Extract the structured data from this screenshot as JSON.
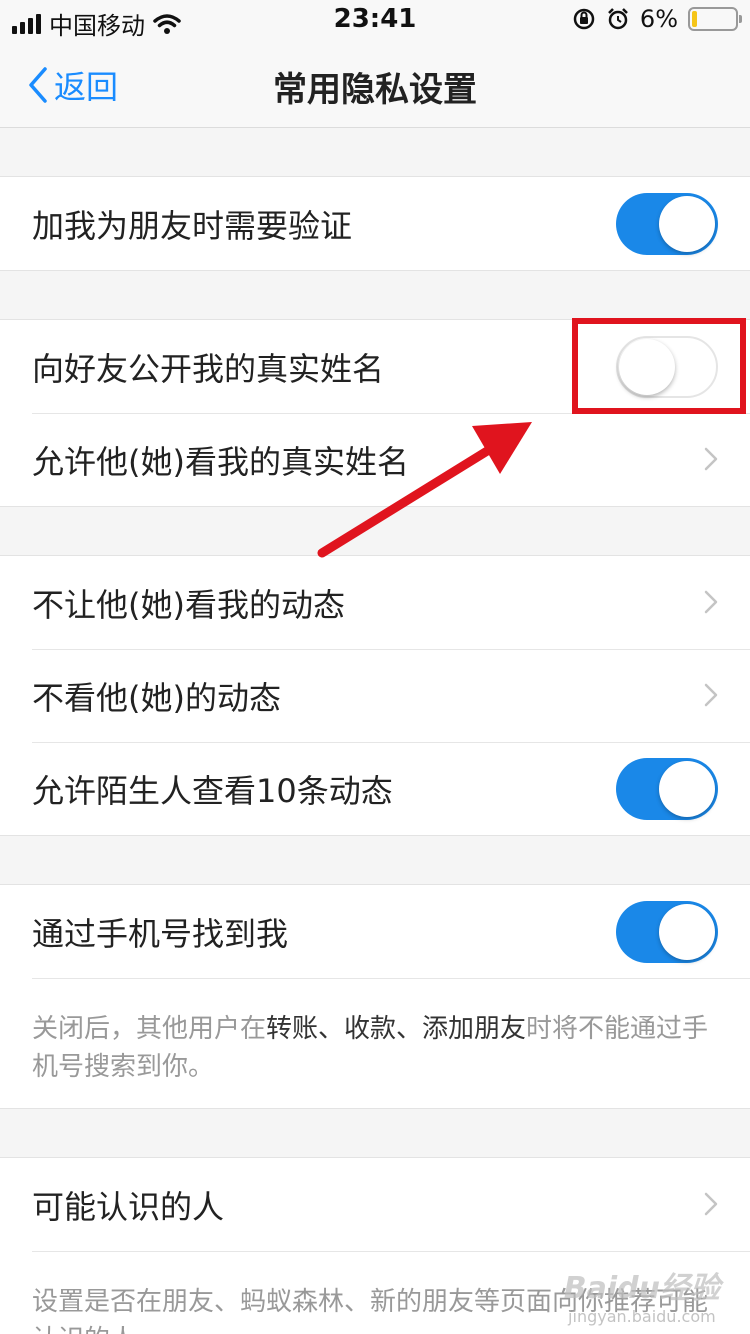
{
  "status": {
    "carrier": "中国移动",
    "time": "23:41",
    "battery": "6%"
  },
  "nav": {
    "back_label": "返回",
    "title": "常用隐私设置"
  },
  "rows": {
    "verify": {
      "label": "加我为朋友时需要验证",
      "toggle": "on"
    },
    "show_real_name": {
      "label": "向好友公开我的真实姓名",
      "toggle": "off"
    },
    "who_sees_name": {
      "label": "允许他(她)看我的真实姓名"
    },
    "hide_my_feed": {
      "label": "不让他(她)看我的动态"
    },
    "hide_their_feed": {
      "label": "不看他(她)的动态"
    },
    "stranger_feed": {
      "label": "允许陌生人查看10条动态",
      "toggle": "on"
    },
    "find_by_phone": {
      "label": "通过手机号找到我",
      "toggle": "on"
    },
    "people_may_know": {
      "label": "可能认识的人"
    }
  },
  "notes": {
    "phone_note_part1": "关闭后，其他用户在",
    "phone_note_bold": "转账、收款、添加朋友",
    "phone_note_part2": "时将不能通过手机号搜索到你。",
    "people_note": "设置是否在朋友、蚂蚁森林、新的朋友等页面向你推荐可能认识的人"
  },
  "watermark": {
    "logo": "Baidu经验",
    "url": "jingyan.baidu.com"
  },
  "colors": {
    "accent": "#1a88e8",
    "link": "#1a8cff",
    "annotation": "#e0141e"
  }
}
